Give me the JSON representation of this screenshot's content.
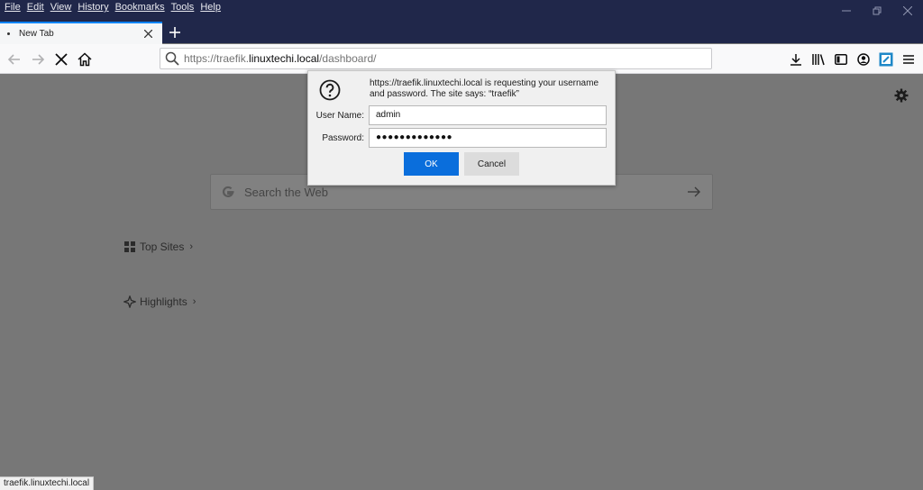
{
  "menu": [
    "File",
    "Edit",
    "View",
    "History",
    "Bookmarks",
    "Tools",
    "Help"
  ],
  "tab": {
    "title": "New Tab"
  },
  "urlbar": {
    "prefix": "https://traefik.",
    "host": "linuxtechi.local",
    "path": "/dashboard/"
  },
  "newtab": {
    "search_placeholder": "Search the Web",
    "top_sites_label": "Top Sites",
    "highlights_label": "Highlights"
  },
  "dialog": {
    "message": "https://traefik.linuxtechi.local is requesting your username and password. The site says: “traefik”",
    "username_label": "User Name:",
    "username_value": "admin",
    "password_label": "Password:",
    "password_value": "●●●●●●●●●●●●●",
    "ok_label": "OK",
    "cancel_label": "Cancel"
  },
  "statusbar": {
    "text": "traefik.linuxtechi.local"
  },
  "colors": {
    "accent": "#0a84ff",
    "titlebar": "#20274a",
    "ok_button": "#0a6edc"
  },
  "icons": [
    "search-icon",
    "back-icon",
    "forward-icon",
    "stop-icon",
    "home-icon",
    "download-icon",
    "library-icon",
    "sidebar-icon",
    "account-icon",
    "extension-icon",
    "menu-icon",
    "gear-icon",
    "google-icon",
    "arrow-right-icon",
    "grid-icon",
    "highlights-icon",
    "question-icon"
  ]
}
